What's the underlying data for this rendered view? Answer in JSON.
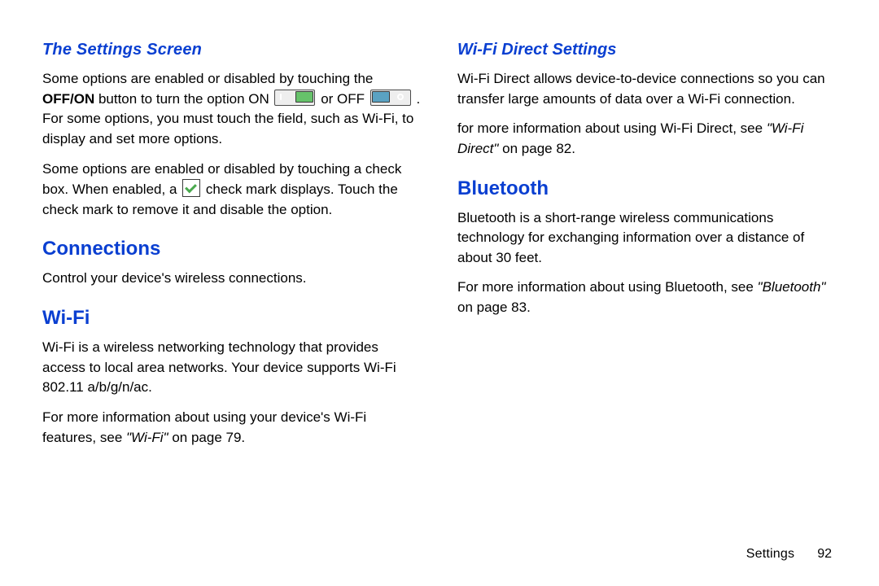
{
  "left": {
    "settingsScreen": {
      "heading": "The Settings Screen",
      "p1a": "Some options are enabled or disabled by touching the ",
      "offon": "OFF/ON",
      "p1b": " button to turn the option ON ",
      "p1c": " or OFF ",
      "p1d": ". For some options, you must touch the field, such as Wi-Fi, to display and set more options.",
      "p2a": "Some options are enabled or disabled by touching a check box. When enabled, a ",
      "p2b": " check mark displays. Touch the check mark to remove it and disable the option."
    },
    "connections": {
      "heading": "Connections",
      "p1": "Control your device's wireless connections."
    },
    "wifi": {
      "heading": "Wi-Fi",
      "p1": "Wi-Fi is a wireless networking technology that provides access to local area networks. Your device supports Wi-Fi 802.11 a/b/g/n/ac.",
      "p2a": "For more information about using your device's Wi-Fi features, see ",
      "p2ref": "\"Wi-Fi\"",
      "p2b": " on page 79."
    }
  },
  "right": {
    "wifiDirect": {
      "heading": "Wi-Fi Direct Settings",
      "p1": "Wi-Fi Direct allows device-to-device connections so you can transfer large amounts of data over a Wi-Fi connection.",
      "p2a": "for more information about using Wi-Fi Direct, see ",
      "p2ref": "\"Wi-Fi Direct\"",
      "p2b": " on page 82."
    },
    "bluetooth": {
      "heading": "Bluetooth",
      "p1": "Bluetooth is a short-range wireless communications technology for exchanging information over a distance of about 30 feet.",
      "p2a": "For more information about using Bluetooth, see ",
      "p2ref": "\"Bluetooth\"",
      "p2b": " on page 83."
    }
  },
  "footer": {
    "section": "Settings",
    "page": "92"
  }
}
